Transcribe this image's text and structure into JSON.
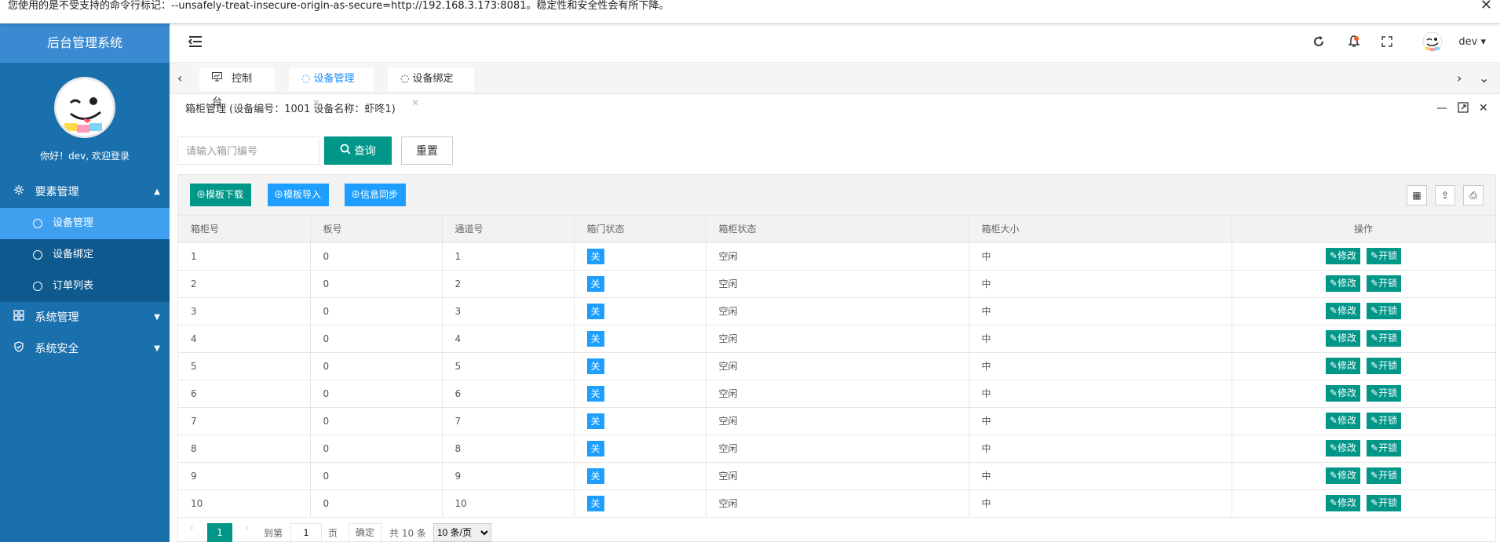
{
  "infobar": {
    "message": "您使用的是不受支持的命令行标记：--unsafely-treat-insecure-origin-as-secure=http://192.168.3.173:8081。稳定性和安全性会有所下降。",
    "close": "✕"
  },
  "sidebar": {
    "brand": "后台管理系统",
    "welcome": "你好！dev, 欢迎登录",
    "groups": [
      {
        "label": "要素管理",
        "icon": "gear-icon",
        "expanded": true,
        "items": [
          {
            "label": "设备管理",
            "active": true
          },
          {
            "label": "设备绑定"
          },
          {
            "label": "订单列表"
          }
        ]
      },
      {
        "label": "系统管理",
        "icon": "grid-icon",
        "expanded": false
      },
      {
        "label": "系统安全",
        "icon": "shield-icon",
        "expanded": false
      }
    ]
  },
  "topbar": {
    "user": "dev",
    "icons": [
      "menu-fold-icon",
      "refresh-icon",
      "bell-icon",
      "fullscreen-icon"
    ]
  },
  "tabs": [
    {
      "label": "控制台",
      "icon": "monitor-icon"
    },
    {
      "label": "设备管理",
      "active": true
    },
    {
      "label": "设备绑定"
    }
  ],
  "panel": {
    "title": "箱柜管理 (设备编号：1001 设备名称：虾咚1)"
  },
  "search": {
    "placeholder": "请输入箱门编号",
    "query_label": "查询",
    "reset_label": "重置"
  },
  "toolbar": {
    "download": "模板下载",
    "import": "模板导入",
    "sync": "信息同步"
  },
  "colors": {
    "sidebar": "#1a70ad",
    "brand": "#3a8ad1",
    "active_menu": "#3fa0f0",
    "primary_green": "#009688",
    "primary_blue": "#1e9fff"
  },
  "table": {
    "columns": [
      "箱柜号",
      "板号",
      "通道号",
      "箱门状态",
      "箱柜状态",
      "箱柜大小",
      "操作"
    ],
    "rows": [
      [
        "1",
        "0",
        "1",
        "关",
        "空闲",
        "中"
      ],
      [
        "2",
        "0",
        "2",
        "关",
        "空闲",
        "中"
      ],
      [
        "3",
        "0",
        "3",
        "关",
        "空闲",
        "中"
      ],
      [
        "4",
        "0",
        "4",
        "关",
        "空闲",
        "中"
      ],
      [
        "5",
        "0",
        "5",
        "关",
        "空闲",
        "中"
      ],
      [
        "6",
        "0",
        "6",
        "关",
        "空闲",
        "中"
      ],
      [
        "7",
        "0",
        "7",
        "关",
        "空闲",
        "中"
      ],
      [
        "8",
        "0",
        "8",
        "关",
        "空闲",
        "中"
      ],
      [
        "9",
        "0",
        "9",
        "关",
        "空闲",
        "中"
      ],
      [
        "10",
        "0",
        "10",
        "关",
        "空闲",
        "中"
      ]
    ],
    "edit_label": "修改",
    "unlock_label": "开锁"
  },
  "pager": {
    "current": "1",
    "goto_label": "到第",
    "page_value": "1",
    "page_unit": "页",
    "confirm": "确定",
    "total": "共 10 条",
    "per_page": "10 条/页"
  }
}
